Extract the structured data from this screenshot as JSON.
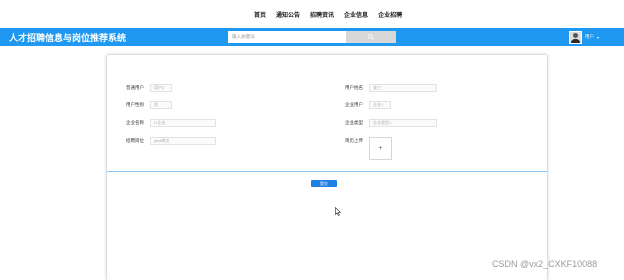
{
  "nav": {
    "items": [
      "首页",
      "通知公告",
      "招聘资讯",
      "企业信息",
      "企业招聘"
    ]
  },
  "banner": {
    "title": "人才招聘信息与岗位推荐系统",
    "search_placeholder": "输入关键词",
    "search_icon": "search-icon",
    "user_name": "用户",
    "caret": "▾",
    "accent_color": "#1e98f0"
  },
  "form": {
    "left": [
      {
        "label": "普通用户",
        "value": "用户2"
      },
      {
        "label": "用户性别",
        "value": "男"
      },
      {
        "label": "企业名称",
        "value": "IT企业"
      },
      {
        "label": "招聘岗位",
        "value": "java岗位"
      }
    ],
    "right": [
      {
        "label": "用户姓名",
        "value": "张三"
      },
      {
        "label": "企业用户",
        "value": "企业1"
      },
      {
        "label": "企业类型",
        "value": "企业类型1"
      }
    ],
    "upload": {
      "label": "简历上传",
      "icon": "+"
    },
    "submit_label": "提交"
  },
  "watermark": "CSDN @vx2_CXKF10088"
}
